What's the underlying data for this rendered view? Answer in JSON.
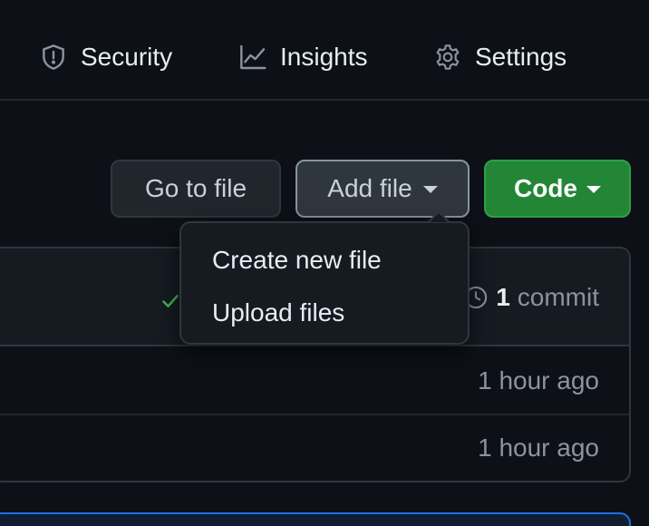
{
  "nav": {
    "security": {
      "label": "Security",
      "icon": "shield-icon"
    },
    "insights": {
      "label": "Insights",
      "icon": "graph-icon"
    },
    "settings": {
      "label": "Settings",
      "icon": "gear-icon"
    }
  },
  "toolbar": {
    "goto_label": "Go to file",
    "add_label": "Add file",
    "code_label": "Code"
  },
  "dropdown": {
    "items": [
      {
        "label": "Create new file"
      },
      {
        "label": "Upload files"
      }
    ]
  },
  "commits": {
    "count": "1",
    "label": "commit"
  },
  "files": {
    "rows": [
      {
        "time": "1 hour ago"
      },
      {
        "time": "1 hour ago"
      }
    ]
  },
  "colors": {
    "background": "#0d1117",
    "code_button": "#238636",
    "success_check": "#3fb950",
    "banner_border": "#1f6feb"
  }
}
